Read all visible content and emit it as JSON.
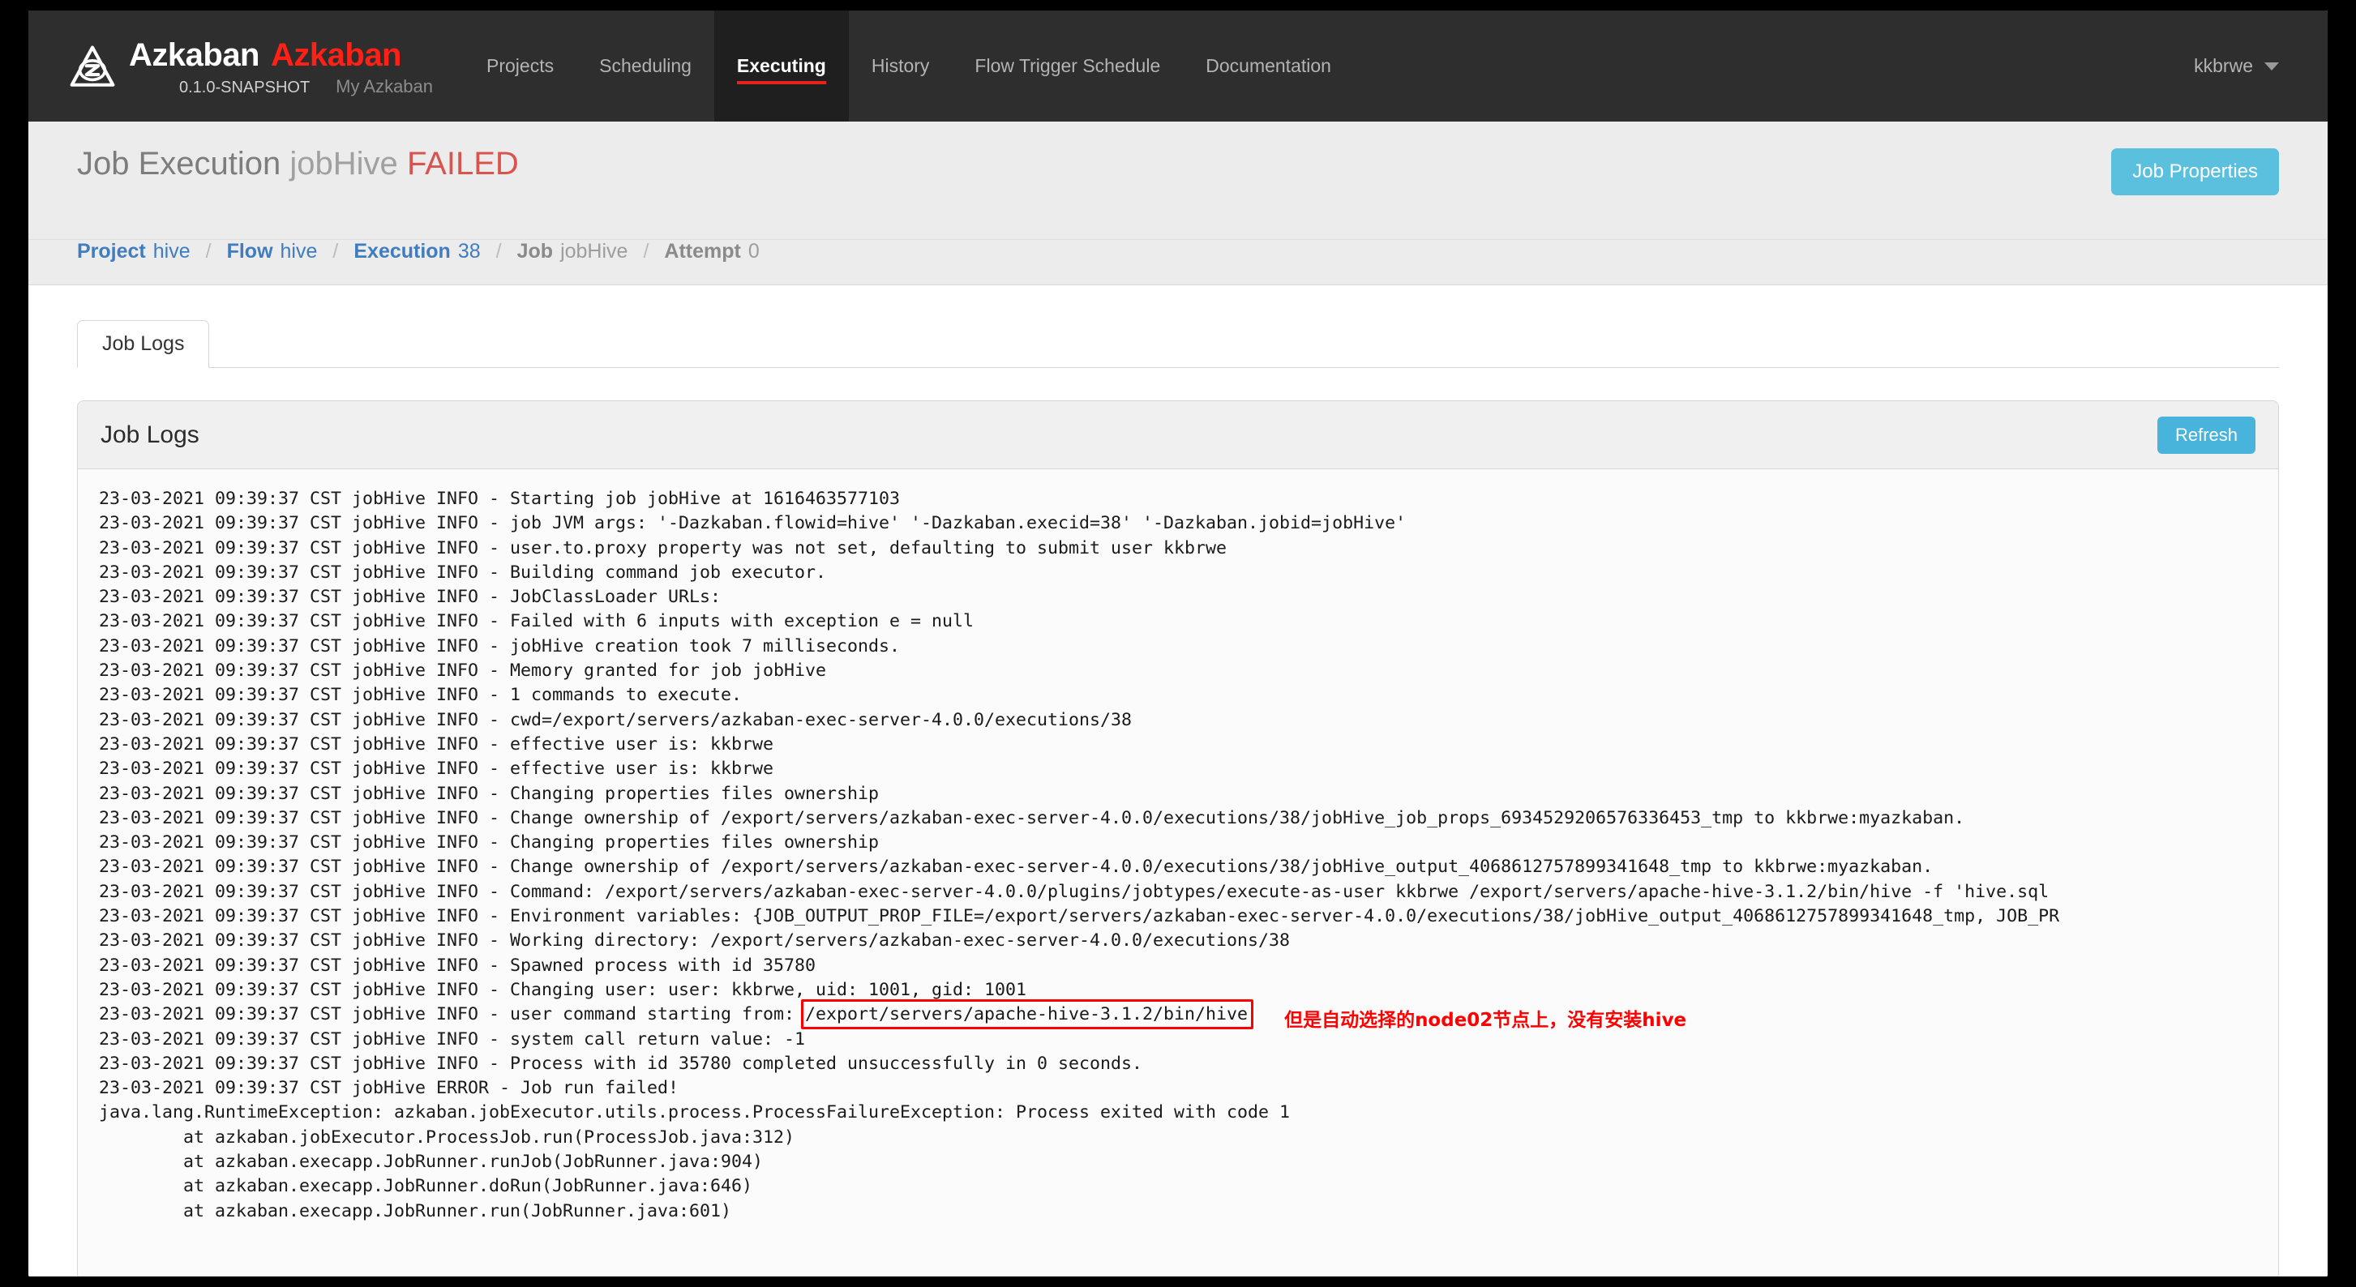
{
  "navbar": {
    "logo_icon": "azkaban-triangle-z-logo",
    "brand": "Azkaban",
    "project_name": "Azkaban",
    "version": "0.1.0-SNAPSHOT",
    "subtitle": "My Azkaban",
    "links": [
      {
        "label": "Projects",
        "active": false
      },
      {
        "label": "Scheduling",
        "active": false
      },
      {
        "label": "Executing",
        "active": true
      },
      {
        "label": "History",
        "active": false
      },
      {
        "label": "Flow Trigger Schedule",
        "active": false
      },
      {
        "label": "Documentation",
        "active": false
      }
    ],
    "user": "kkbrwe",
    "user_caret_icon": "chevron-down-icon"
  },
  "header": {
    "title_prefix": "Job Execution",
    "title_job": "jobHive",
    "title_status": "FAILED",
    "job_properties_label": "Job Properties",
    "accent_blue": "#5bc0de",
    "status_red": "#d9534f"
  },
  "breadcrumb": [
    {
      "key": "Project",
      "value": "hive",
      "link": true
    },
    {
      "key": "Flow",
      "value": "hive",
      "link": true
    },
    {
      "key": "Execution",
      "value": "38",
      "link": true
    },
    {
      "key": "Job",
      "value": "jobHive",
      "link": false
    },
    {
      "key": "Attempt",
      "value": "0",
      "link": false
    }
  ],
  "breadcrumb_separator": "/",
  "tabs": [
    {
      "label": "Job Logs",
      "active": true
    }
  ],
  "panel": {
    "title": "Job Logs",
    "refresh_label": "Refresh"
  },
  "log_lines": [
    "23-03-2021 09:39:37 CST jobHive INFO - Starting job jobHive at 1616463577103",
    "23-03-2021 09:39:37 CST jobHive INFO - job JVM args: '-Dazkaban.flowid=hive' '-Dazkaban.execid=38' '-Dazkaban.jobid=jobHive'",
    "23-03-2021 09:39:37 CST jobHive INFO - user.to.proxy property was not set, defaulting to submit user kkbrwe",
    "23-03-2021 09:39:37 CST jobHive INFO - Building command job executor.",
    "23-03-2021 09:39:37 CST jobHive INFO - JobClassLoader URLs:",
    "23-03-2021 09:39:37 CST jobHive INFO - Failed with 6 inputs with exception e = null",
    "23-03-2021 09:39:37 CST jobHive INFO - jobHive creation took 7 milliseconds.",
    "23-03-2021 09:39:37 CST jobHive INFO - Memory granted for job jobHive",
    "23-03-2021 09:39:37 CST jobHive INFO - 1 commands to execute.",
    "23-03-2021 09:39:37 CST jobHive INFO - cwd=/export/servers/azkaban-exec-server-4.0.0/executions/38",
    "23-03-2021 09:39:37 CST jobHive INFO - effective user is: kkbrwe",
    "23-03-2021 09:39:37 CST jobHive INFO - effective user is: kkbrwe",
    "23-03-2021 09:39:37 CST jobHive INFO - Changing properties files ownership",
    "23-03-2021 09:39:37 CST jobHive INFO - Change ownership of /export/servers/azkaban-exec-server-4.0.0/executions/38/jobHive_job_props_6934529206576336453_tmp to kkbrwe:myazkaban.",
    "23-03-2021 09:39:37 CST jobHive INFO - Changing properties files ownership",
    "23-03-2021 09:39:37 CST jobHive INFO - Change ownership of /export/servers/azkaban-exec-server-4.0.0/executions/38/jobHive_output_4068612757899341648_tmp to kkbrwe:myazkaban.",
    "23-03-2021 09:39:37 CST jobHive INFO - Command: /export/servers/azkaban-exec-server-4.0.0/plugins/jobtypes/execute-as-user kkbrwe /export/servers/apache-hive-3.1.2/bin/hive -f 'hive.sql",
    "23-03-2021 09:39:37 CST jobHive INFO - Environment variables: {JOB_OUTPUT_PROP_FILE=/export/servers/azkaban-exec-server-4.0.0/executions/38/jobHive_output_4068612757899341648_tmp, JOB_PR",
    "23-03-2021 09:39:37 CST jobHive INFO - Working directory: /export/servers/azkaban-exec-server-4.0.0/executions/38",
    "23-03-2021 09:39:37 CST jobHive INFO - Spawned process with id 35780",
    "23-03-2021 09:39:37 CST jobHive INFO - Changing user: user: kkbrwe, uid: 1001, gid: 1001",
    "23-03-2021 09:39:37 CST jobHive INFO - user command starting from: /export/servers/apache-hive-3.1.2/bin/hive",
    "23-03-2021 09:39:37 CST jobHive INFO - system call return value: -1",
    "23-03-2021 09:39:37 CST jobHive INFO - Process with id 35780 completed unsuccessfully in 0 seconds.",
    "23-03-2021 09:39:37 CST jobHive ERROR - Job run failed!",
    "java.lang.RuntimeException: azkaban.jobExecutor.utils.process.ProcessFailureException: Process exited with code 1",
    "        at azkaban.jobExecutor.ProcessJob.run(ProcessJob.java:312)",
    "        at azkaban.execapp.JobRunner.runJob(JobRunner.java:904)",
    "        at azkaban.execapp.JobRunner.doRun(JobRunner.java:646)",
    "        at azkaban.execapp.JobRunner.run(JobRunner.java:601)"
  ],
  "annotation": {
    "highlighted_text": "/export/servers/apache-hive-3.1.2/bin/hive",
    "note": "但是自动选择的node02节点上，没有安装hive",
    "color": "#ff0000"
  }
}
